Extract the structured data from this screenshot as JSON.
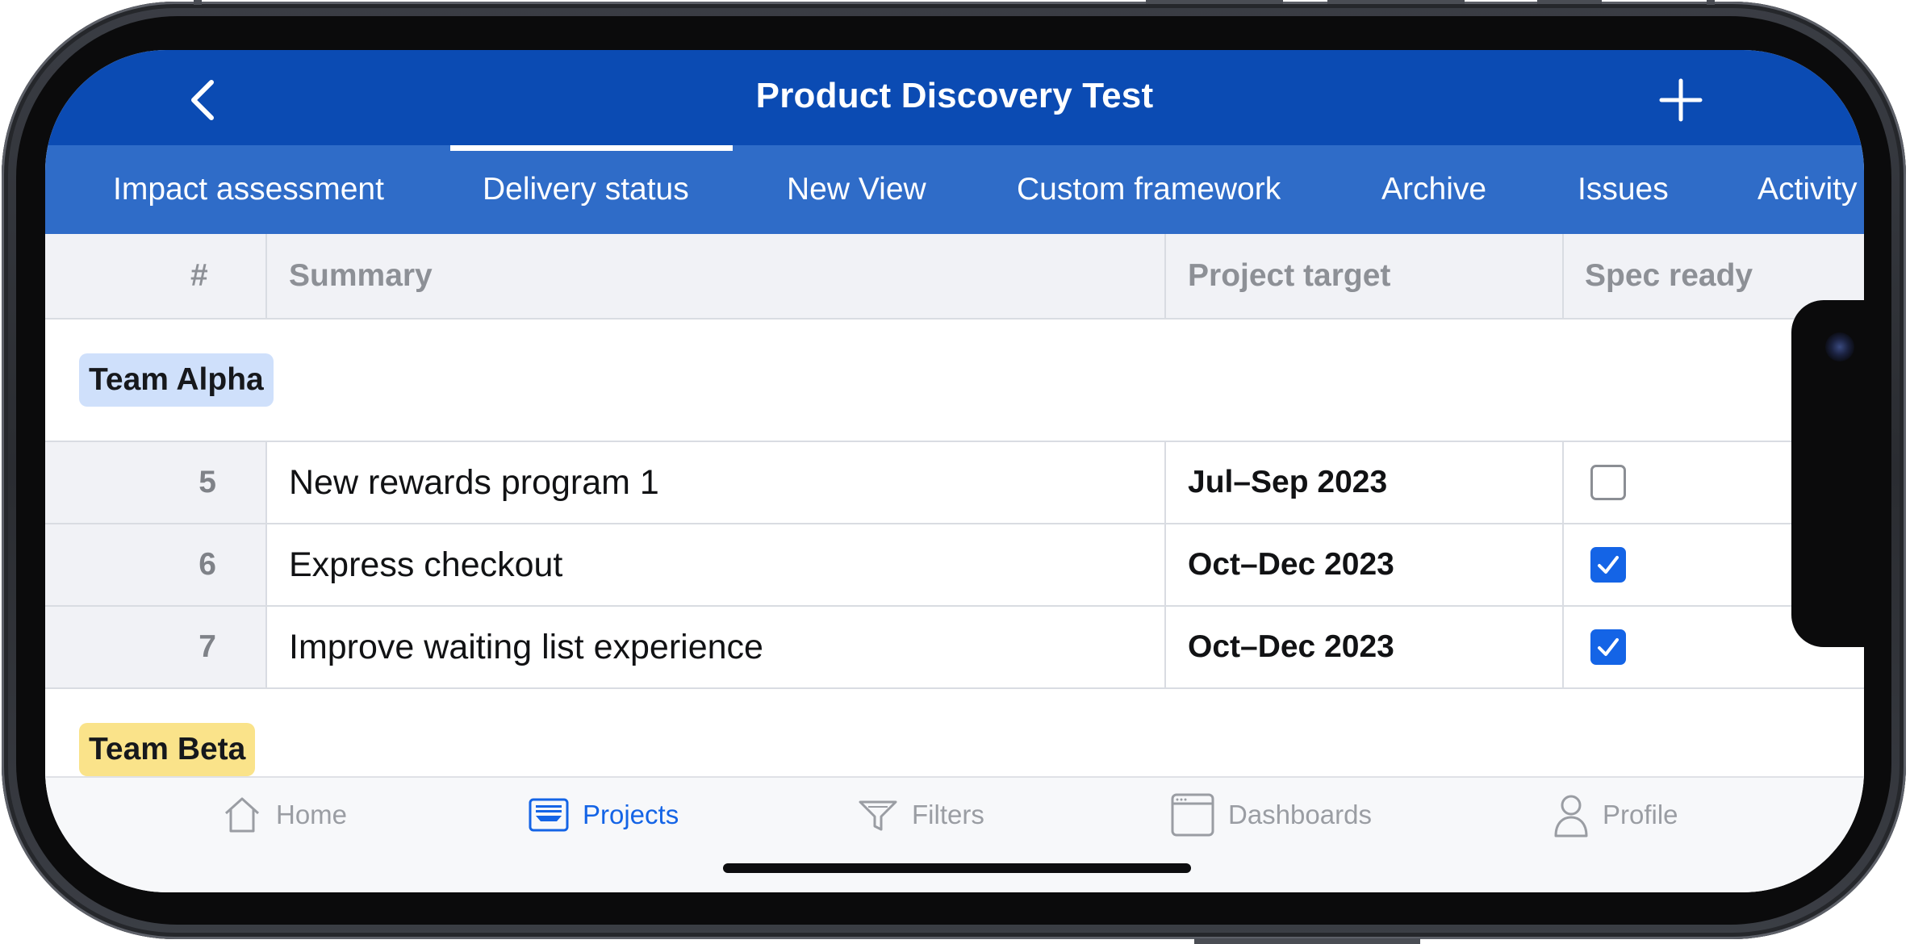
{
  "header": {
    "title": "Product Discovery Test",
    "back_icon": "chevron-left-icon",
    "add_icon": "plus-icon"
  },
  "tabs": [
    {
      "label": "Impact assessment"
    },
    {
      "label": "Delivery status",
      "active": true
    },
    {
      "label": "New View"
    },
    {
      "label": "Custom framework"
    },
    {
      "label": "Archive"
    },
    {
      "label": "Issues"
    },
    {
      "label": "Activity"
    }
  ],
  "table": {
    "columns": [
      "#",
      "Summary",
      "Project target",
      "Spec ready"
    ],
    "groups": [
      {
        "name": "Team Alpha",
        "color": "#cfe0fb",
        "rows": [
          {
            "num": "5",
            "summary": "New rewards program 1",
            "target": "Jul–Sep 2023",
            "spec_ready": false
          },
          {
            "num": "6",
            "summary": "Express checkout",
            "target": "Oct–Dec 2023",
            "spec_ready": true
          },
          {
            "num": "7",
            "summary": "Improve waiting list experience",
            "target": "Oct–Dec 2023",
            "spec_ready": true
          }
        ]
      },
      {
        "name": "Team Beta",
        "color": "#fae38a",
        "rows": []
      }
    ]
  },
  "bottom_nav": [
    {
      "label": "Home",
      "icon": "home-icon",
      "active": false
    },
    {
      "label": "Projects",
      "icon": "projects-icon",
      "active": true
    },
    {
      "label": "Filters",
      "icon": "filter-icon",
      "active": false
    },
    {
      "label": "Dashboards",
      "icon": "dashboard-icon",
      "active": false
    },
    {
      "label": "Profile",
      "icon": "profile-icon",
      "active": false
    }
  ],
  "colors": {
    "header": "#0b4bb3",
    "tabs": "#2f6cc8",
    "accent": "#1464e6"
  }
}
